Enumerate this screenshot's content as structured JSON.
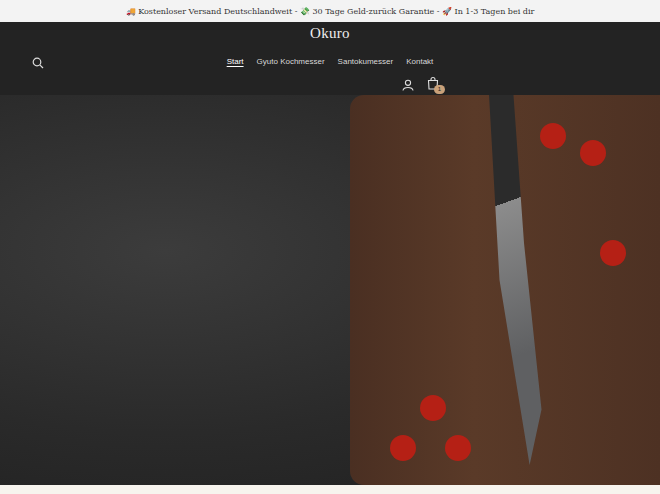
{
  "announcement": "🚚 Kostenloser Versand Deutschlandweit - 💸 30 Tage Geld-zurück Garantie - 🚀 In 1-3 Tagen bei dir",
  "logo": "Okuro",
  "nav": [
    {
      "label": "Start",
      "selected": true
    },
    {
      "label": "Gyuto Kochmesser",
      "selected": false
    },
    {
      "label": "Santokumesser",
      "selected": false
    },
    {
      "label": "Kontakt",
      "selected": false
    }
  ],
  "cart": {
    "count": "1"
  }
}
